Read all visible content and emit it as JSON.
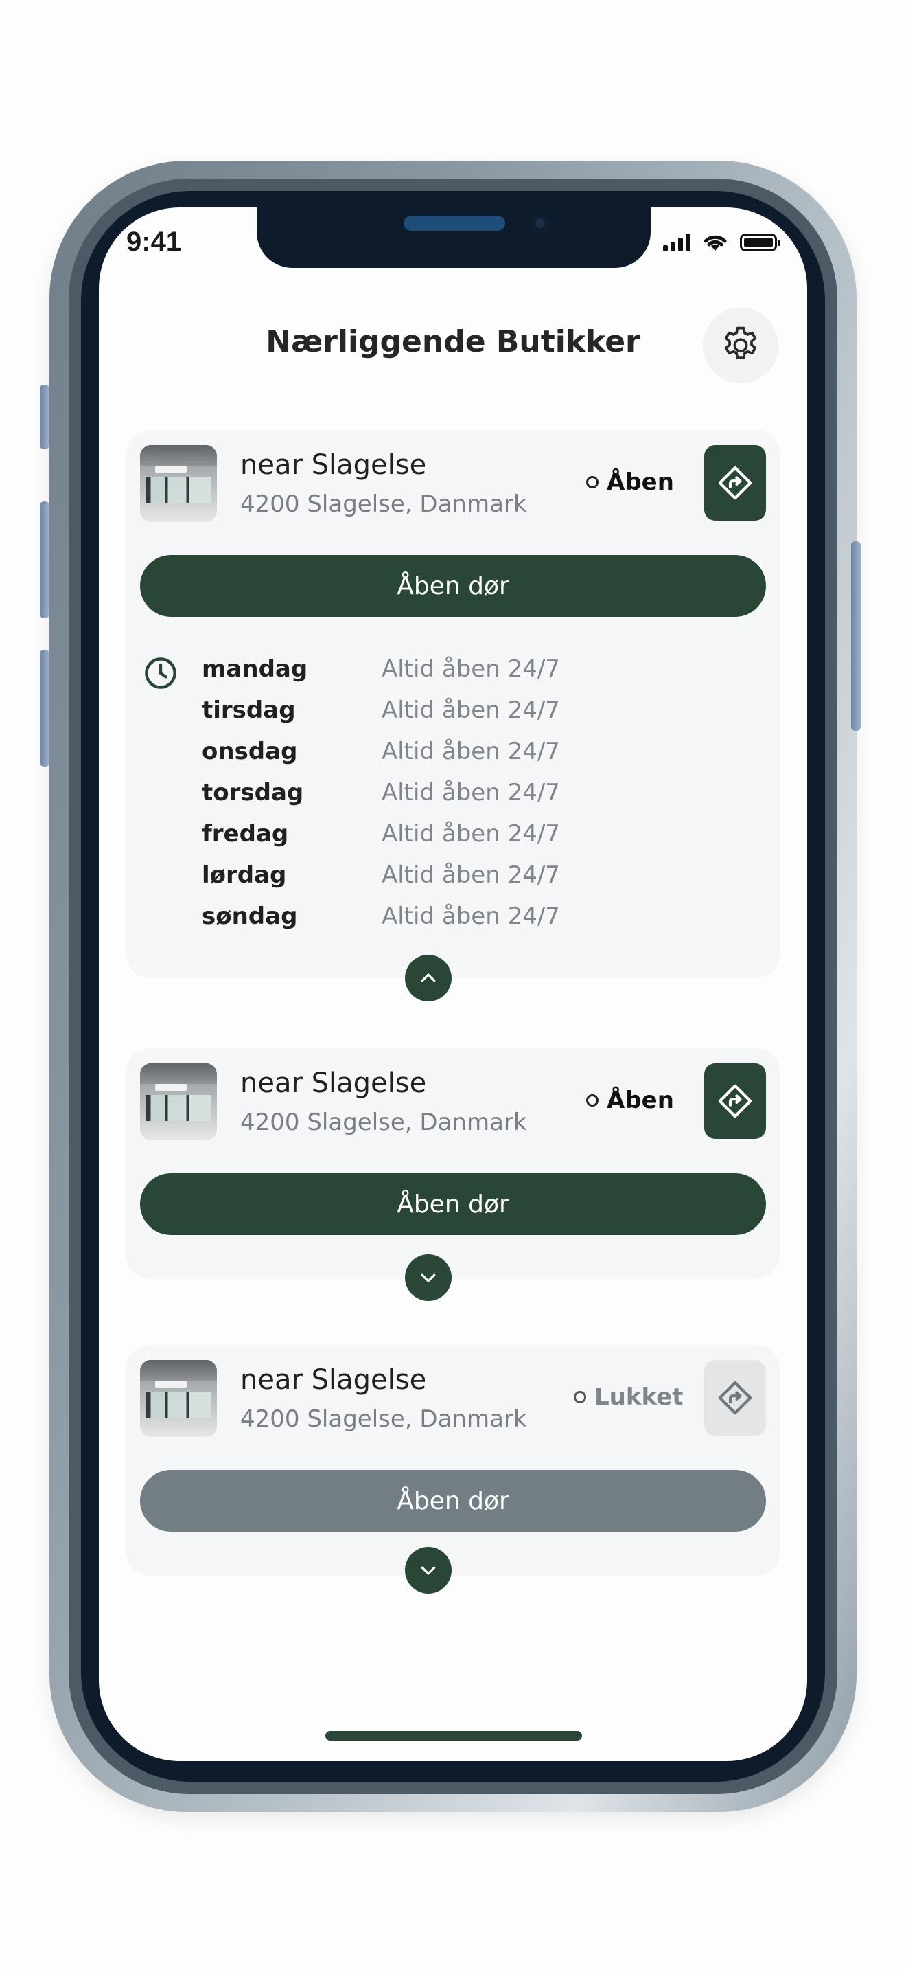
{
  "status_bar": {
    "time": "9:41"
  },
  "header": {
    "title": "Nærliggende Butikker"
  },
  "hours_labels": {
    "days": [
      "mandag",
      "tirsdag",
      "onsdag",
      "torsdag",
      "fredag",
      "lørdag",
      "søndag"
    ],
    "value": "Altid åben 24/7"
  },
  "stores": [
    {
      "name": "near Slagelse",
      "address": "4200 Slagelse, Danmark",
      "status": "Åben",
      "open": true,
      "button": "Åben dør",
      "expanded": true
    },
    {
      "name": "near Slagelse",
      "address": "4200 Slagelse, Danmark",
      "status": "Åben",
      "open": true,
      "button": "Åben dør",
      "expanded": false
    },
    {
      "name": "near Slagelse",
      "address": "4200 Slagelse, Danmark",
      "status": "Lukket",
      "open": false,
      "button": "Åben dør",
      "expanded": false
    }
  ],
  "colors": {
    "accent": "#2a4637",
    "card": "#f5f6f8",
    "disabled": "#737d84",
    "muted_text": "#7a7f86"
  },
  "icons": [
    "gear-icon",
    "directions-icon",
    "clock-icon",
    "chevron-up-icon",
    "chevron-down-icon",
    "store-thumbnail"
  ]
}
